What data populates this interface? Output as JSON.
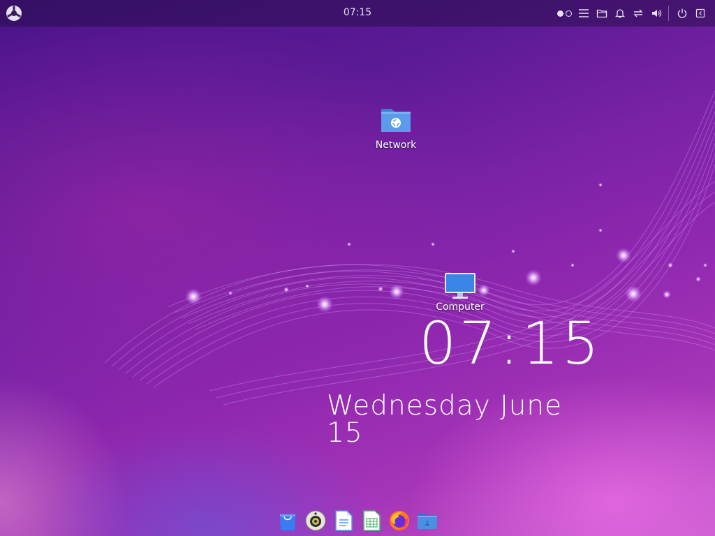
{
  "panel": {
    "clock": "07:15",
    "launcher_icon": "distro-logo-icon",
    "workspaces": [
      {
        "active": true
      },
      {
        "active": false
      }
    ],
    "tray_icons": [
      "menu-icon",
      "folder-icon",
      "bell-icon",
      "network-transfer-icon",
      "volume-icon",
      "power-icon",
      "collapse-panel-icon"
    ]
  },
  "desktop": {
    "icons": [
      {
        "label": "Network",
        "icon": "network-folder-icon"
      },
      {
        "label": "Computer",
        "icon": "computer-monitor-icon"
      }
    ],
    "clock_widget": {
      "time": "07:15",
      "date": "Wednesday June 15"
    }
  },
  "dock": {
    "items": [
      {
        "name": "software-center-icon",
        "color": "#3a7bf2"
      },
      {
        "name": "music-player-icon",
        "color": "#e9e6dc"
      },
      {
        "name": "text-document-icon",
        "color": "#5a8fe6"
      },
      {
        "name": "spreadsheet-icon",
        "color": "#4bb36a"
      },
      {
        "name": "firefox-icon",
        "color": "#ff7a1a"
      },
      {
        "name": "file-manager-icon",
        "color": "#4a90e2"
      }
    ]
  },
  "colors": {
    "accent": "#7a22a6",
    "panel_bg": "#1e0a3c"
  }
}
